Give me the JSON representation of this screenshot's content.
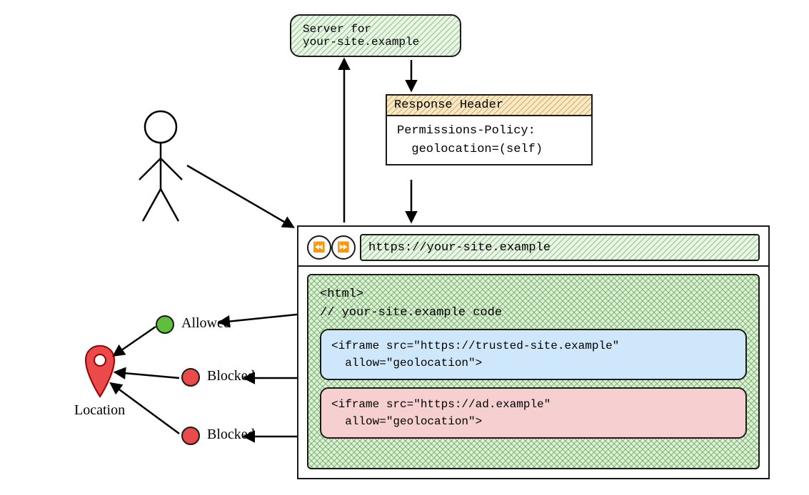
{
  "server": {
    "line1": "Server for",
    "line2": "your-site.example"
  },
  "response": {
    "title": "Response Header",
    "line1": "Permissions-Policy:",
    "line2": "  geolocation=(self)"
  },
  "browser": {
    "url": "https://your-site.example",
    "viewport": {
      "html_open": "<html>",
      "comment": "// your-site.example code",
      "iframes": [
        {
          "kind": "trusted",
          "line1": "<iframe src=\"https://trusted-site.example\"",
          "line2": "  allow=\"geolocation\">"
        },
        {
          "kind": "ad",
          "line1": "<iframe src=\"https://ad.example\"",
          "line2": "  allow=\"geolocation\">"
        }
      ]
    }
  },
  "statuses": [
    {
      "result": "Allowed",
      "color": "green"
    },
    {
      "result": "Blocked",
      "color": "red"
    },
    {
      "result": "Blocked",
      "color": "red"
    }
  ],
  "location_label": "Location",
  "icons": {
    "back_glyph": "⏪",
    "fwd_glyph": "⏩"
  }
}
